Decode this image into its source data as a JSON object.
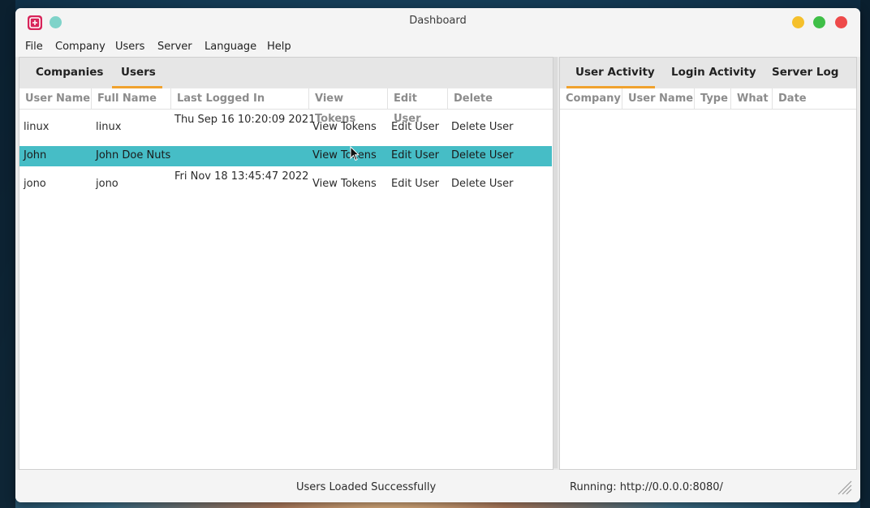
{
  "window": {
    "title": "Dashboard"
  },
  "menu": [
    "File",
    "Company",
    "Users",
    "Server",
    "Language",
    "Help"
  ],
  "left_panel": {
    "tabs": [
      {
        "label": "Companies",
        "active": false
      },
      {
        "label": "Users",
        "active": true
      }
    ],
    "columns": [
      "User Name",
      "Full Name",
      "Last Logged In",
      "View Tokens",
      "Edit User",
      "Delete"
    ],
    "rows": [
      {
        "user_name": "linux",
        "full_name": "linux",
        "last_logged_in": "Thu Sep 16 10:20:09 2021",
        "view_tokens": "View Tokens",
        "edit_user": "Edit User",
        "delete": "Delete User",
        "selected": false
      },
      {
        "user_name": "John",
        "full_name": "John Doe Nuts",
        "last_logged_in": "",
        "view_tokens": "View Tokens",
        "edit_user": "Edit User",
        "delete": "Delete User",
        "selected": true
      },
      {
        "user_name": "jono",
        "full_name": "jono",
        "last_logged_in": "Fri Nov 18 13:45:47 2022",
        "view_tokens": "View Tokens",
        "edit_user": "Edit User",
        "delete": "Delete User",
        "selected": false
      }
    ]
  },
  "right_panel": {
    "tabs": [
      {
        "label": "User Activity",
        "active": true
      },
      {
        "label": "Login Activity",
        "active": false
      },
      {
        "label": "Server Log",
        "active": false
      }
    ],
    "columns": [
      "Company",
      "User Name",
      "Type",
      "What",
      "Date"
    ]
  },
  "status": {
    "message": "Users Loaded Successfully",
    "server": "Running: http://0.0.0.0:8080/"
  },
  "colors": {
    "accent": "#f0a22e",
    "selection": "#46bdc6",
    "app_icon": "#d8245a"
  }
}
